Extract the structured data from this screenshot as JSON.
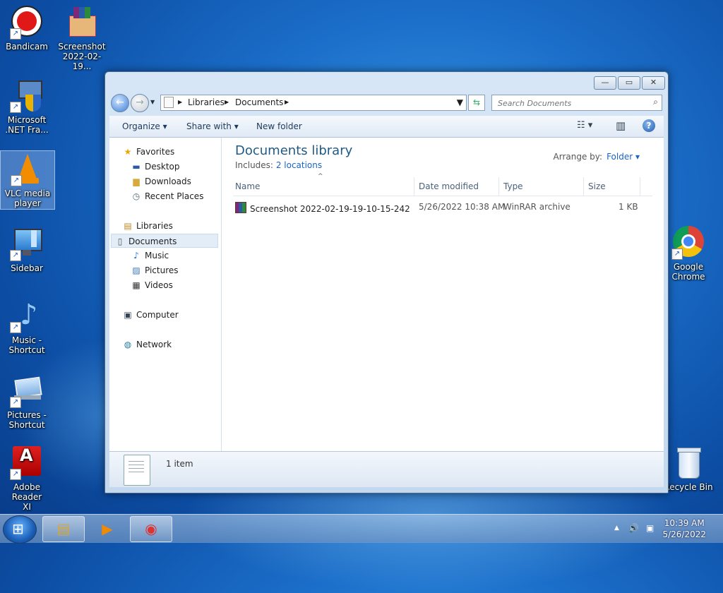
{
  "desktop": {
    "icons": [
      {
        "label_line1": "Bandicam",
        "label_line2": "",
        "icon": "bandicam-icon"
      },
      {
        "label_line1": "Screenshot",
        "label_line2": "2022-02-19...",
        "icon": "winrar-archive-icon"
      },
      {
        "label_line1": "Microsoft",
        "label_line2": ".NET Fra...",
        "icon": "dotnet-installer-icon"
      },
      {
        "label_line1": "VLC media",
        "label_line2": "player",
        "icon": "vlc-icon"
      },
      {
        "label_line1": "Sidebar",
        "label_line2": "",
        "icon": "sidebar-icon"
      },
      {
        "label_line1": "Music -",
        "label_line2": "Shortcut",
        "icon": "music-note-icon"
      },
      {
        "label_line1": "Pictures -",
        "label_line2": "Shortcut",
        "icon": "pictures-icon"
      },
      {
        "label_line1": "Adobe Reader",
        "label_line2": "XI",
        "icon": "adobe-reader-icon"
      },
      {
        "label_line1": "Google",
        "label_line2": "Chrome",
        "icon": "chrome-icon"
      },
      {
        "label_line1": "Recycle Bin",
        "label_line2": "",
        "icon": "recycle-bin-icon"
      }
    ],
    "shortcut_glyph": "↗"
  },
  "window": {
    "buttons": {
      "minimize": "—",
      "maximize": "▭",
      "close": "✕"
    },
    "nav": {
      "back": "←",
      "forward": "→",
      "dropdown": "▼"
    },
    "address": {
      "sep": "▶",
      "crumbs": [
        "Libraries",
        "Documents"
      ],
      "dropdown": "▼",
      "refresh": "⇆"
    },
    "search": {
      "placeholder": "Search Documents",
      "icon": "⌕"
    },
    "toolbar": {
      "organize": "Organize ▾",
      "share_with": "Share with ▾",
      "new_folder": "New folder",
      "views_icon": "☷ ▾",
      "preview_icon": "▥",
      "help_icon": "?"
    },
    "nav_pane": {
      "favorites": "Favorites",
      "desktop": "Desktop",
      "downloads": "Downloads",
      "recent_places": "Recent Places",
      "libraries": "Libraries",
      "documents": "Documents",
      "music": "Music",
      "pictures": "Pictures",
      "videos": "Videos",
      "computer": "Computer",
      "network": "Network",
      "icons": {
        "star": "★",
        "monitor": "▬",
        "folder": "▆",
        "clock": "◷",
        "library": "▤",
        "doc": "▯",
        "note": "♪",
        "picture": "▨",
        "film": "▦",
        "computer": "▣",
        "network": "◍"
      }
    },
    "library": {
      "title": "Documents library",
      "includes_label": "Includes:",
      "includes_link": "2 locations",
      "arrange_label": "Arrange by:",
      "arrange_value": "Folder ▾"
    },
    "columns": {
      "name": "Name",
      "date_modified": "Date modified",
      "type": "Type",
      "size": "Size",
      "sort_arrow": "^"
    },
    "files": [
      {
        "name": "Screenshot 2022-02-19-19-10-15-242",
        "date_modified": "5/26/2022 10:38 AM",
        "type": "WinRAR archive",
        "size": "1 KB"
      }
    ],
    "details": {
      "item_count": "1 item"
    }
  },
  "taskbar": {
    "pinned": [
      {
        "icon": "explorer-folder-icon",
        "glyph": "▤"
      },
      {
        "icon": "media-player-icon",
        "glyph": "▶"
      },
      {
        "icon": "chrome-icon",
        "glyph": "◉"
      }
    ],
    "tray": {
      "show_hidden": "▲",
      "volume": "🔊",
      "network": "▣"
    },
    "clock": {
      "time": "10:39 AM",
      "date": "5/26/2022"
    }
  }
}
